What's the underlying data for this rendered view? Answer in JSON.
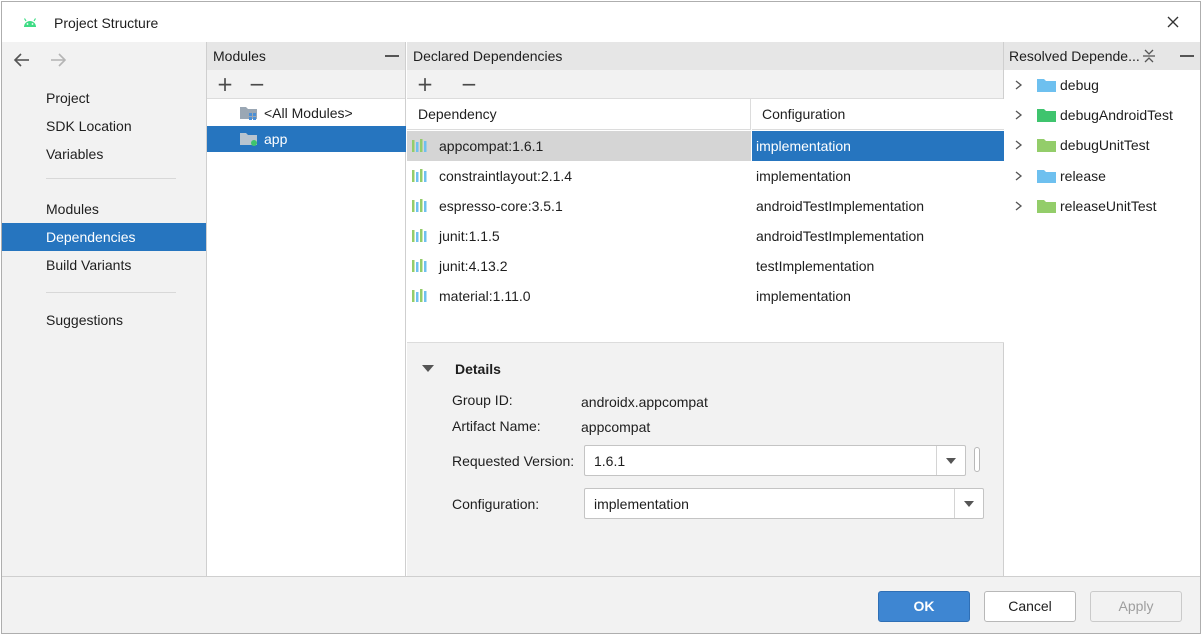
{
  "window": {
    "title": "Project Structure"
  },
  "nav": {
    "back_icon": "arrow-left-icon",
    "forward_icon": "arrow-right-icon",
    "items": [
      {
        "label": "Project"
      },
      {
        "label": "SDK Location"
      },
      {
        "label": "Variables"
      },
      {
        "label": "Modules"
      },
      {
        "label": "Dependencies"
      },
      {
        "label": "Build Variants"
      },
      {
        "label": "Suggestions"
      }
    ],
    "selected": "Dependencies"
  },
  "modules": {
    "header": "Modules",
    "items": [
      {
        "label": "<All Modules>"
      },
      {
        "label": "app"
      }
    ],
    "selected": "app"
  },
  "declared": {
    "header": "Declared Dependencies",
    "columns": {
      "dependency": "Dependency",
      "configuration": "Configuration"
    },
    "rows": [
      {
        "dependency": "appcompat:1.6.1",
        "configuration": "implementation"
      },
      {
        "dependency": "constraintlayout:2.1.4",
        "configuration": "implementation"
      },
      {
        "dependency": "espresso-core:3.5.1",
        "configuration": "androidTestImplementation"
      },
      {
        "dependency": "junit:1.1.5",
        "configuration": "androidTestImplementation"
      },
      {
        "dependency": "junit:4.13.2",
        "configuration": "testImplementation"
      },
      {
        "dependency": "material:1.11.0",
        "configuration": "implementation"
      }
    ],
    "selected_row": 0
  },
  "details": {
    "title": "Details",
    "group_id_label": "Group ID:",
    "group_id_value": "androidx.appcompat",
    "artifact_label": "Artifact Name:",
    "artifact_value": "appcompat",
    "requested_version_label": "Requested Version:",
    "requested_version_value": "1.6.1",
    "configuration_label": "Configuration:",
    "configuration_value": "implementation"
  },
  "resolved": {
    "header": "Resolved Depende...",
    "items": [
      {
        "label": "debug",
        "color": "#6ec0ef"
      },
      {
        "label": "debugAndroidTest",
        "color": "#3fc46e"
      },
      {
        "label": "debugUnitTest",
        "color": "#93cd6a"
      },
      {
        "label": "release",
        "color": "#6ec0ef"
      },
      {
        "label": "releaseUnitTest",
        "color": "#93cd6a"
      }
    ]
  },
  "footer": {
    "ok": "OK",
    "cancel": "Cancel",
    "apply": "Apply"
  },
  "colors": {
    "accent": "#2675bf",
    "ok_button": "#3e86d2",
    "android_green": "#3ddc84"
  }
}
